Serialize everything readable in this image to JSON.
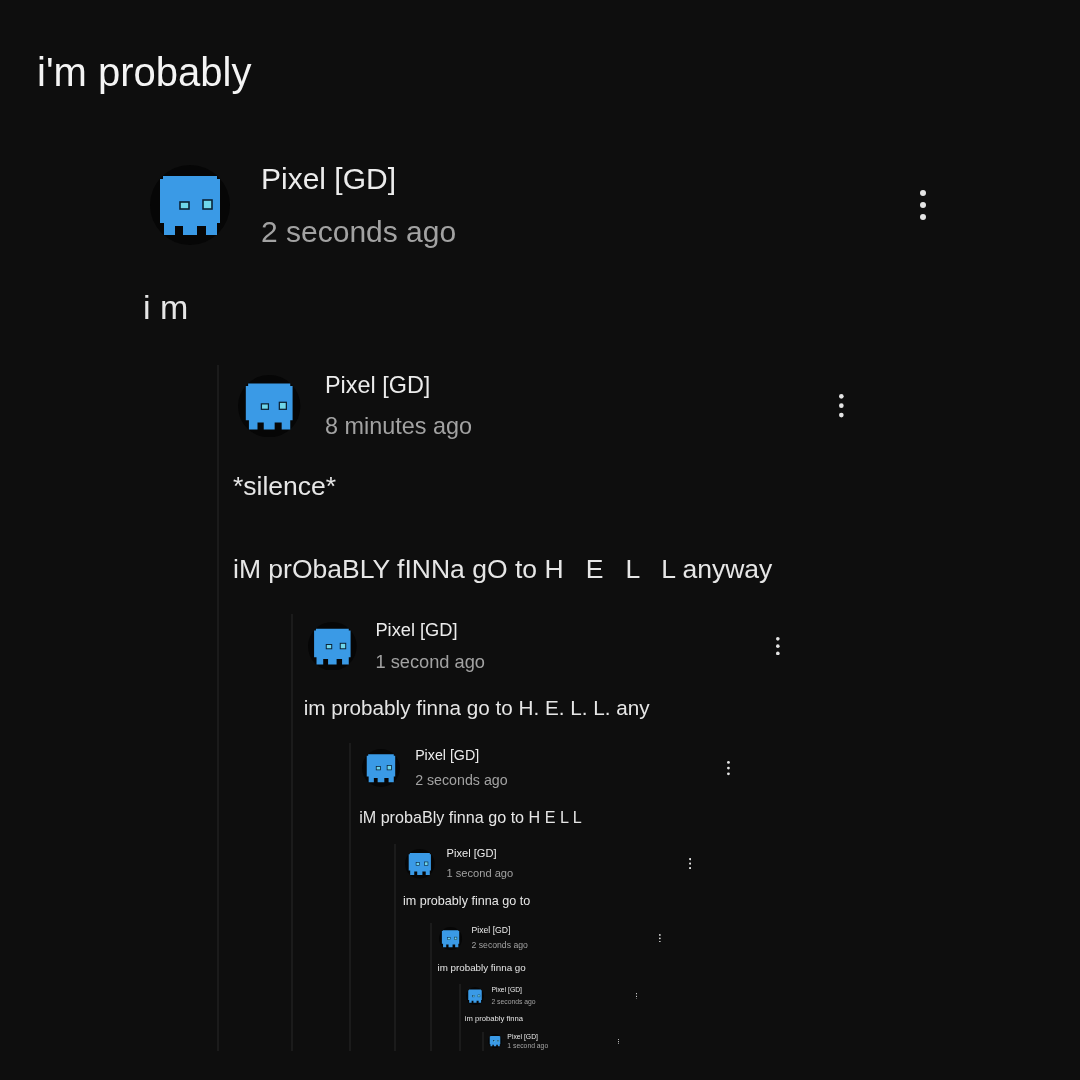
{
  "caption": "i'm probably",
  "comment": {
    "author": "Pixel [GD]",
    "time": "2 seconds ago",
    "text": [
      "i m"
    ],
    "children": [
      {
        "author": "Pixel [GD]",
        "time": "8 minutes ago",
        "text": [
          "*silence*",
          "iM prObaBLY fINNa gO to H   E   L   L anyway"
        ],
        "children": [
          {
            "author": "Pixel [GD]",
            "time": "1 second ago",
            "text": [
              "im probably finna go to H. E. L. L. any"
            ],
            "children": [
              {
                "author": "Pixel [GD]",
                "time": "2 seconds ago",
                "text": [
                  "iM probaBly finna go to H E L L"
                ],
                "children": [
                  {
                    "author": "Pixel [GD]",
                    "time": "1 second ago",
                    "text": [
                      "im probably finna go to"
                    ],
                    "children": [
                      {
                        "author": "Pixel [GD]",
                        "time": "2 seconds ago",
                        "text": [
                          "im probably finna go"
                        ],
                        "children": [
                          {
                            "author": "Pixel [GD]",
                            "time": "2 seconds ago",
                            "text": [
                              "im probably finna"
                            ],
                            "children": [
                              {
                                "author": "Pixel [GD]",
                                "time": "1 second ago"
                              }
                            ]
                          }
                        ]
                      }
                    ]
                  }
                ]
              }
            ]
          }
        ]
      }
    ]
  }
}
